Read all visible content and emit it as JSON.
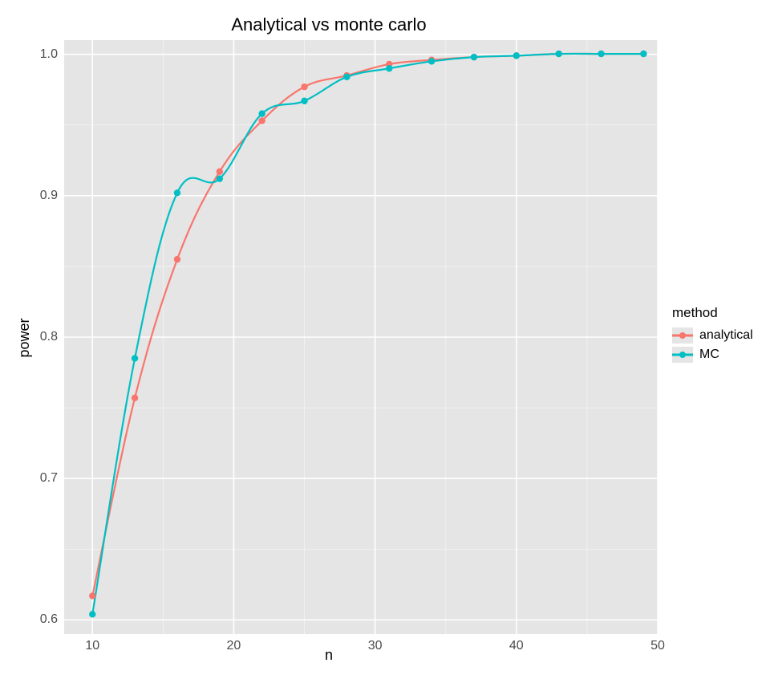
{
  "chart_data": {
    "type": "line",
    "title": "Analytical vs monte carlo",
    "xlabel": "n",
    "ylabel": "power",
    "legend_title": "method",
    "x": [
      10,
      13,
      16,
      19,
      22,
      25,
      28,
      31,
      34,
      37,
      40,
      43,
      46,
      49
    ],
    "series": [
      {
        "name": "analytical",
        "color": "#f8766d",
        "values": [
          0.617,
          0.757,
          0.855,
          0.917,
          0.953,
          0.977,
          0.985,
          0.993,
          0.996,
          0.998,
          0.999,
          1.0003,
          1.0003,
          1.0003
        ]
      },
      {
        "name": "MC",
        "color": "#00bfc4",
        "values": [
          0.604,
          0.785,
          0.902,
          0.912,
          0.958,
          0.967,
          0.984,
          0.99,
          0.995,
          0.998,
          0.999,
          1.0003,
          1.0003,
          1.0003
        ]
      }
    ],
    "xlim": [
      8,
      50
    ],
    "ylim": [
      0.59,
      1.01
    ],
    "x_ticks_major": [
      10,
      20,
      30,
      40,
      50
    ],
    "x_ticks_minor": [
      15,
      25,
      35,
      45
    ],
    "y_ticks_major": [
      0.6,
      0.7,
      0.8,
      0.9,
      1.0
    ],
    "y_ticks_minor": [
      0.65,
      0.75,
      0.85,
      0.95
    ],
    "y_tick_labels": [
      "0.6",
      "0.7",
      "0.8",
      "0.9",
      "1.0"
    ],
    "x_tick_labels": [
      "10",
      "20",
      "30",
      "40",
      "50"
    ]
  }
}
